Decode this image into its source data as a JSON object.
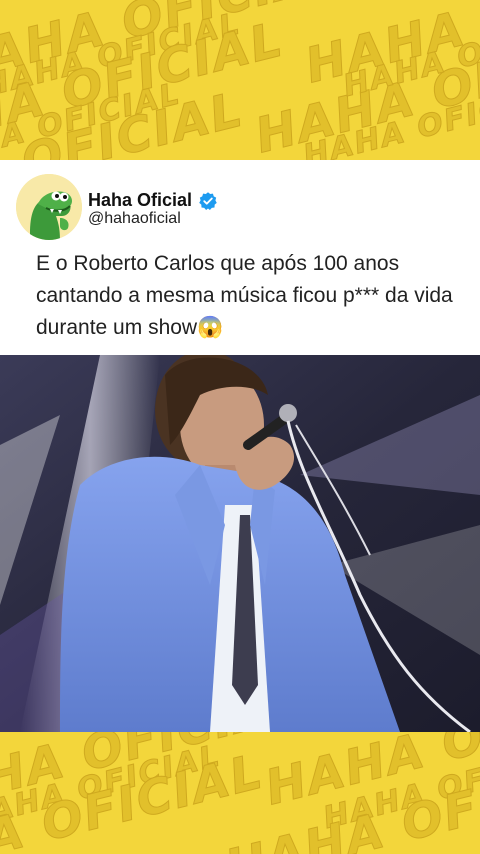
{
  "watermark": {
    "text": "HAHA OFICIAL"
  },
  "post": {
    "display_name": "Haha Oficial",
    "handle": "@hahaoficial",
    "verified": true,
    "text": "E o Roberto Carlos que após 100 anos cantando a mesma música ficou p*** da vida durante um show😱"
  },
  "colors": {
    "background": "#f3d63b",
    "card": "#ffffff",
    "verified_badge": "#1d9bf0",
    "jacket": "#6f8edc"
  },
  "icons": {
    "avatar": "green-dinosaur-avatar",
    "verified": "verified-badge-icon"
  }
}
